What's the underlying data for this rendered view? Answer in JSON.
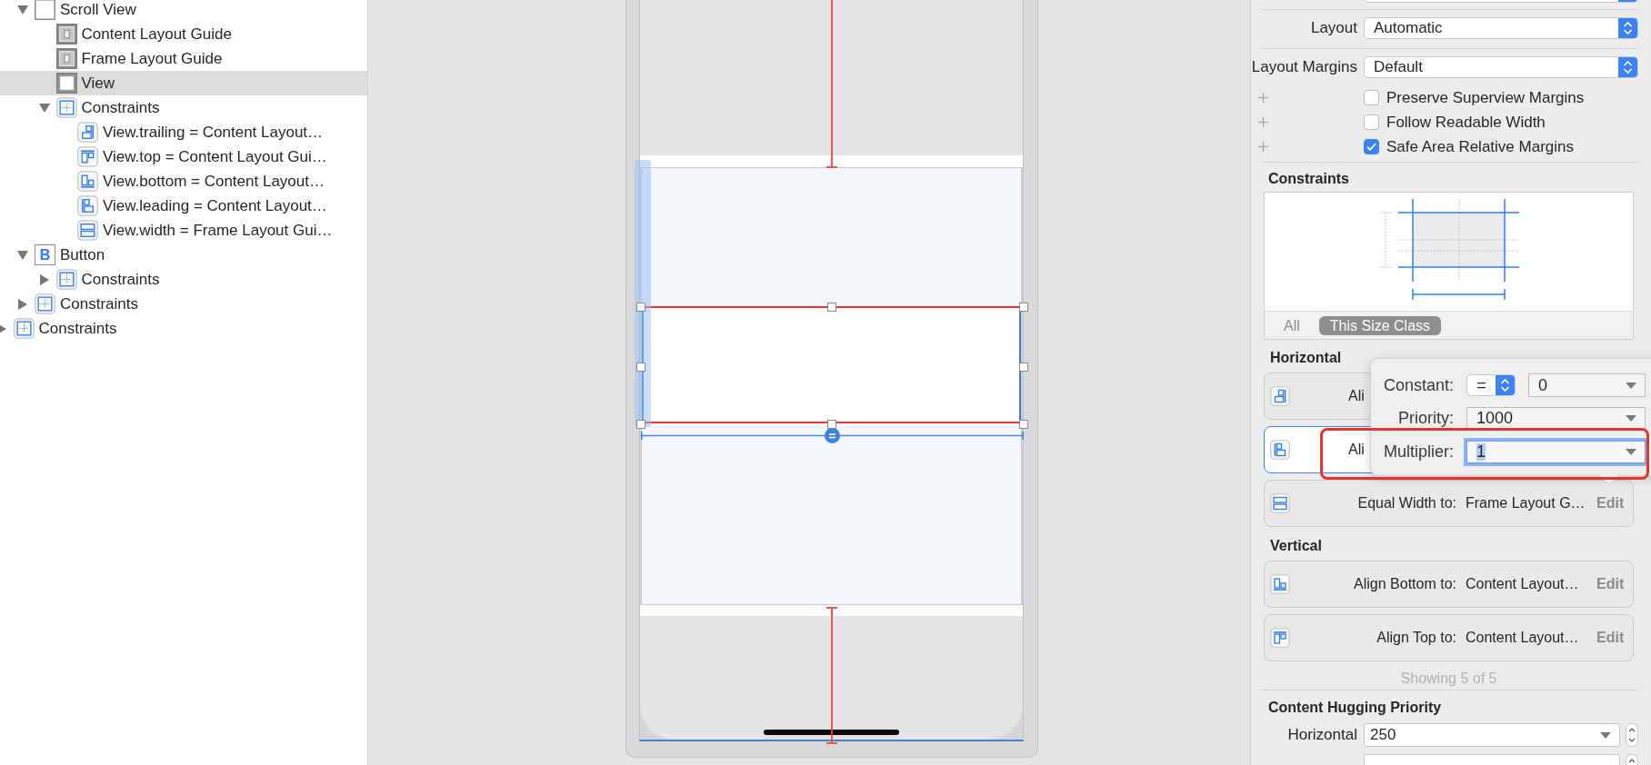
{
  "outline": {
    "items": [
      {
        "children": [
          {
            "label": "Scroll View",
            "kind": "scroll_view",
            "expanded": true,
            "selected": false,
            "children": [
              {
                "label": "Content Layout Guide",
                "kind": "layout_guide",
                "selected": false
              },
              {
                "label": "Frame Layout Guide",
                "kind": "layout_guide",
                "selected": false
              },
              {
                "label": "View",
                "kind": "view",
                "selected": true
              },
              {
                "label": "Constraints",
                "kind": "constraints",
                "expanded": true,
                "selected": false,
                "children": [
                  {
                    "label": "View.trailing = Content Layout…",
                    "kind": "trailing",
                    "selected": false
                  },
                  {
                    "label": "View.top = Content Layout Gui…",
                    "kind": "top",
                    "selected": false
                  },
                  {
                    "label": "View.bottom = Content Layout…",
                    "kind": "bottom",
                    "selected": false
                  },
                  {
                    "label": "View.leading = Content Layout…",
                    "kind": "leading",
                    "selected": false
                  },
                  {
                    "label": "View.width = Frame Layout Gui…",
                    "kind": "width",
                    "selected": false
                  }
                ]
              }
            ]
          },
          {
            "label": "Button",
            "kind": "button",
            "glyph": "B",
            "expanded": true,
            "selected": false,
            "children": [
              {
                "label": "Constraints",
                "kind": "constraints",
                "expanded": false,
                "selected": false
              }
            ]
          },
          {
            "label": "Constraints",
            "kind": "constraints",
            "expanded": false,
            "selected": false
          }
        ]
      },
      {
        "label": "Constraints",
        "kind": "constraints",
        "expanded": false,
        "selected": false
      }
    ]
  },
  "inspector": {
    "popups": [
      {
        "label": "Layout",
        "value": "Automatic"
      },
      {
        "label": "Layout Margins",
        "value": "Default"
      }
    ],
    "options": [
      {
        "label": "Preserve Superview Margins",
        "checked": false
      },
      {
        "label": "Follow Readable Width",
        "checked": false
      },
      {
        "label": "Safe Area Relative Margins",
        "checked": true
      }
    ],
    "constraints": {
      "title": "Constraints",
      "filters": [
        {
          "label": "All",
          "selected": false
        },
        {
          "label": "This Size Class",
          "selected": true
        }
      ]
    },
    "groups": [
      {
        "title": "Horizontal",
        "items": [
          {
            "kind": "trailing",
            "label": "Ali",
            "selected": false
          },
          {
            "kind": "leading",
            "label": "Ali",
            "selected": true
          },
          {
            "kind": "width",
            "label": "Equal Width to:",
            "target": "Frame Layout G…",
            "action": "Edit",
            "selected": false
          }
        ]
      },
      {
        "title": "Vertical",
        "items": [
          {
            "kind": "bottom",
            "label": "Align Bottom to:",
            "target": "Content Layout…",
            "action": "Edit",
            "selected": false
          },
          {
            "kind": "top",
            "label": "Align Top to:",
            "target": "Content Layout…",
            "action": "Edit",
            "selected": false
          }
        ]
      }
    ],
    "summary": "Showing 5 of 5",
    "hugging": {
      "title": "Content Hugging Priority",
      "rows": [
        {
          "label": "Horizontal",
          "value": "250"
        }
      ]
    }
  },
  "popover": {
    "rows": [
      {
        "kind": "relation",
        "label": "Constant:",
        "relation": "=",
        "value": "0",
        "focused": false
      },
      {
        "kind": "combo",
        "label": "Priority:",
        "value": "1000",
        "focused": false
      },
      {
        "kind": "combo",
        "label": "Multiplier:",
        "value": "1",
        "focused": true
      }
    ]
  }
}
